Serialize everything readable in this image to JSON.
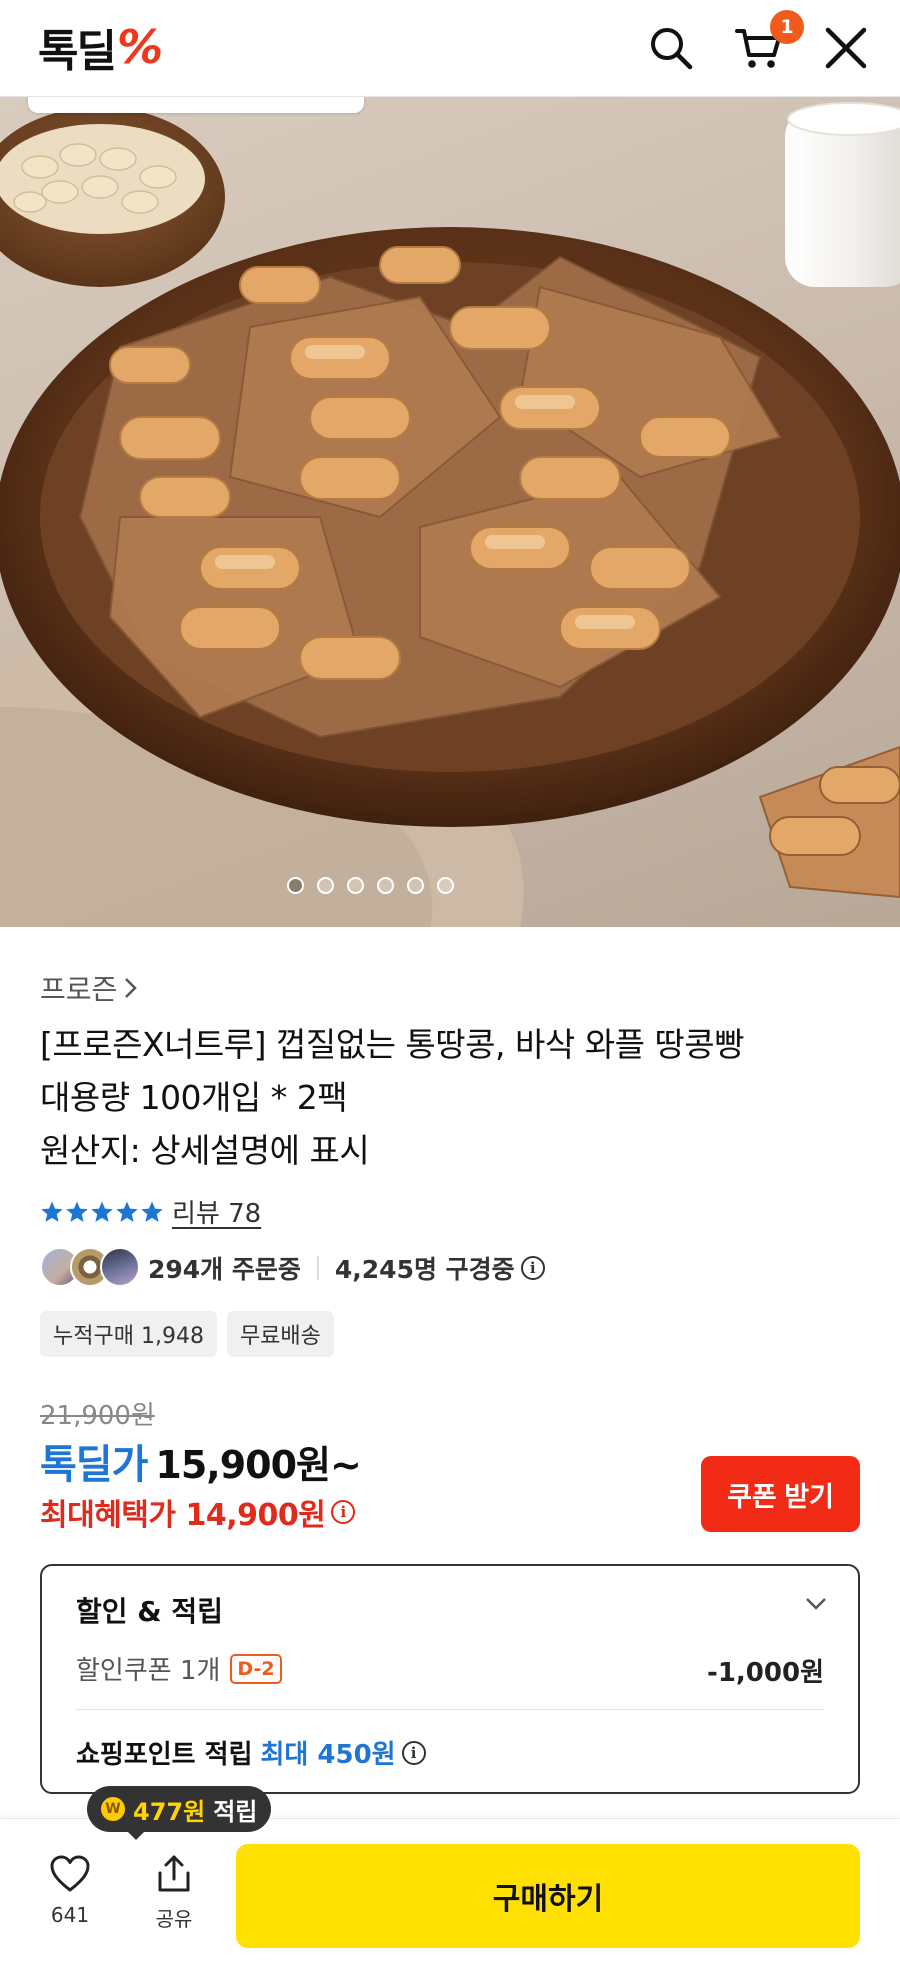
{
  "header": {
    "logo_word": "톡딜",
    "logo_mark": "%",
    "cart_count": "1",
    "icons": [
      "search-icon",
      "cart-icon",
      "close-icon"
    ]
  },
  "gallery": {
    "slide_count": 6,
    "active_index": 0
  },
  "product": {
    "brand": "프로즌",
    "title_lines": [
      "[프로즌X너트루] 껍질없는 통땅콩, 바삭 와플 땅콩빵",
      "대용량 100개입 * 2팩",
      "원산지: 상세설명에 표시"
    ],
    "rating_stars": 5,
    "review_label": "리뷰 78",
    "orders_text": "294개 주문중",
    "viewers_text": "4,245명 구경중",
    "chips": [
      "누적구매 1,948",
      "무료배송"
    ]
  },
  "price": {
    "original": "21,900원",
    "deal_label": "톡딜가",
    "deal_price": "15,900원~",
    "max_benefit": "최대혜택가 14,900원",
    "coupon_button": "쿠폰 받기"
  },
  "discount": {
    "title": "할인 & 적립",
    "coupon_label": "할인쿠폰 1개",
    "dday": "D-2",
    "coupon_amount": "-1,000원",
    "point_label": "쇼핑포인트 적립",
    "point_max": "최대 450원"
  },
  "bottom": {
    "tooltip_amount": "477원",
    "tooltip_suffix": "적립",
    "like_count": "641",
    "share_label": "공유",
    "buy_label": "구매하기"
  },
  "colors": {
    "accent_blue": "#1e76d4",
    "accent_red": "#e12a1b",
    "coupon_red": "#f22b17",
    "buy_yellow": "#ffe000",
    "badge_orange": "#f05a1a"
  }
}
